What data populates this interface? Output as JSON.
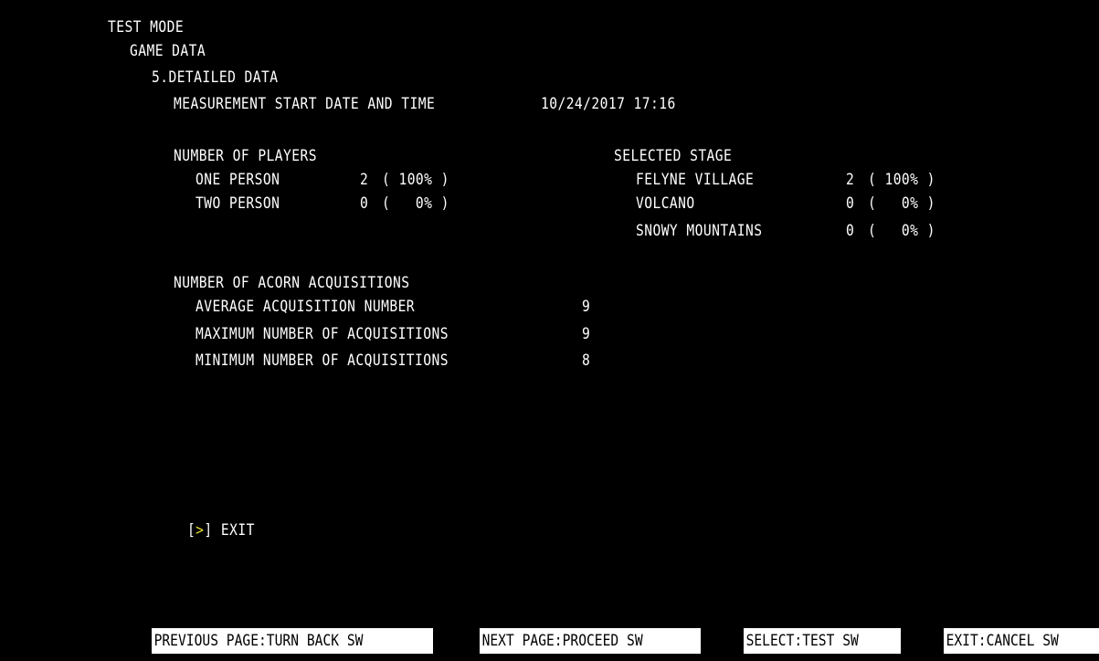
{
  "header": {
    "mode": "TEST MODE",
    "section": "GAME DATA",
    "page_title": "5.DETAILED DATA"
  },
  "measurement": {
    "label": "MEASUREMENT START DATE AND TIME",
    "value": "10/24/2017 17:16"
  },
  "players": {
    "heading": "NUMBER OF PLAYERS",
    "rows": [
      {
        "label": "ONE PERSON",
        "count": "2",
        "percent": "( 100% )"
      },
      {
        "label": "TWO PERSON",
        "count": "0",
        "percent": "(   0% )"
      }
    ]
  },
  "stage": {
    "heading": "SELECTED STAGE",
    "rows": [
      {
        "label": "FELYNE VILLAGE",
        "count": "2",
        "percent": "( 100% )"
      },
      {
        "label": "VOLCANO",
        "count": "0",
        "percent": "(   0% )"
      },
      {
        "label": "SNOWY MOUNTAINS",
        "count": "0",
        "percent": "(   0% )"
      }
    ]
  },
  "acorns": {
    "heading": "NUMBER OF ACORN ACQUISITIONS",
    "rows": [
      {
        "label": "AVERAGE ACQUISITION NUMBER",
        "value": "9"
      },
      {
        "label": "MAXIMUM NUMBER OF ACQUISITIONS",
        "value": "9"
      },
      {
        "label": "MINIMUM NUMBER OF ACQUISITIONS",
        "value": "8"
      }
    ]
  },
  "menu": {
    "bracket_open": "[",
    "cursor": ">",
    "bracket_close": "]",
    "exit_label": "EXIT",
    "cursor_color": "#e6df2a"
  },
  "footer": {
    "previous": "PREVIOUS PAGE:TURN BACK SW",
    "next": "NEXT PAGE:PROCEED SW",
    "select": "SELECT:TEST SW",
    "exit": "EXIT:CANCEL SW"
  },
  "colors": {
    "background": "#000000",
    "text": "#ffffff",
    "footer_bg": "#ffffff",
    "footer_text": "#000000"
  }
}
